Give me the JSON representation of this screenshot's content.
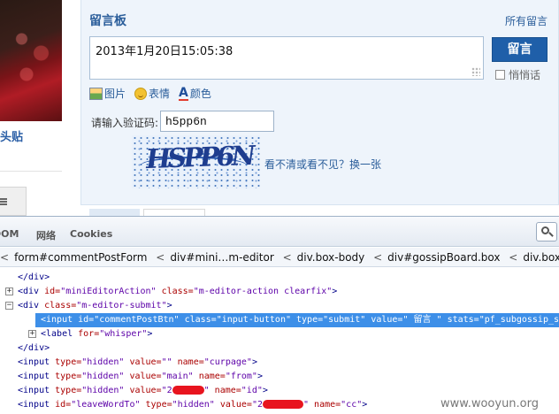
{
  "left": {
    "link_text": "头贴"
  },
  "board": {
    "title": "留言板",
    "all_link": "所有留言",
    "editor_text": "2013年1月20日15:05:38",
    "submit_label": "留言",
    "whisper_label": "悄悄话",
    "tools": [
      {
        "label": "图片",
        "icon": "picture-icon"
      },
      {
        "label": "表情",
        "icon": "emoticon-icon"
      },
      {
        "label": "颜色",
        "icon": "text-color-icon"
      }
    ],
    "captcha_label": "请输入验证码:",
    "captcha_value": "h5pp6n",
    "captcha_image_text": "HSPP6N",
    "refresh_link": "看不清或看不见？换一张"
  },
  "devtools": {
    "tabs": [
      "DOM",
      "网络",
      "Cookies"
    ],
    "breadcrumb": [
      "form#commentPostForm",
      "div#mini…m-editor",
      "div.box-body",
      "div#gossipBoard.box",
      "div.box-holder"
    ],
    "breadcrumb_sep": "<",
    "tree": {
      "l1": {
        "tag": "</div>"
      },
      "l2": {
        "open": "<div",
        "a1": " id=",
        "v1": "\"miniEditorAction\"",
        "a2": " class=",
        "v2": "\"m-editor-action clearfix\"",
        "close": ">"
      },
      "l3": {
        "open": "<div",
        "a1": " class=",
        "v1": "\"m-editor-submit\"",
        "close": ">"
      },
      "l4": {
        "open": "<input",
        "a1": " id=",
        "v1": "\"commentPostBtn\"",
        "a2": " class=",
        "v2": "\"input-button\"",
        "a3": " type=",
        "v3": "\"submit\"",
        "a4": " value=",
        "v4": "\" 留言 \"",
        "a5": " stats=",
        "v5": "\"pf_subgossip_self\"",
        "close": ">"
      },
      "l5": {
        "open": "<label",
        "a1": " for=",
        "v1": "\"whisper\"",
        "close": ">"
      },
      "l6": {
        "tag": "</div>"
      },
      "l7": {
        "open": "<input",
        "a1": " type=",
        "v1": "\"hidden\"",
        "a2": " value=",
        "v2": "\"\"",
        "a3": " name=",
        "v3": "\"curpage\"",
        "close": ">"
      },
      "l8": {
        "open": "<input",
        "a1": " type=",
        "v1": "\"hidden\"",
        "a2": " value=",
        "v2": "\"main\"",
        "a3": " name=",
        "v3": "\"from\"",
        "close": ">"
      },
      "l9": {
        "open": "<input",
        "a1": " type=",
        "v1": "\"hidden\"",
        "a2": " value=",
        "v2_pre": "\"2",
        "v2_post": "\"",
        "a3": " name=",
        "v3": "\"id\"",
        "close": ">"
      },
      "l10": {
        "open": "<input",
        "a1": " id=",
        "v1": "\"leaveWordTo\"",
        "a2": " type=",
        "v2": "\"hidden\"",
        "a3": " value=",
        "v3_pre": "\"2",
        "v3_post": "\"",
        "a4": " name=",
        "v4": "\"cc\"",
        "close": ">"
      }
    }
  },
  "watermark": "www.wooyun.org",
  "colors": {
    "accent": "#1f5fa9",
    "link": "#2a5d9a",
    "selection": "#3d8fe8",
    "redaction": "#e8141e"
  }
}
